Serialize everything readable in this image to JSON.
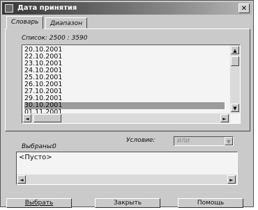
{
  "window": {
    "title": "Дата принятия",
    "close_label": "✕"
  },
  "tabs": [
    {
      "label": "Словарь",
      "active": true
    },
    {
      "label": "Диапазон",
      "active": false
    }
  ],
  "list": {
    "header": "Список:  2500 : 3590",
    "items": [
      "20.10.2001",
      "22.10.2001",
      "23.10.2001",
      "24.10.2001",
      "25.10.2001",
      "26.10.2001",
      "27.10.2001",
      "29.10.2001",
      "30.10.2001",
      "01.11.2001"
    ],
    "selected_index": 8
  },
  "condition": {
    "label": "Условие:",
    "value": "ИЛИ"
  },
  "selected": {
    "label": "Выбраны:",
    "count": "0",
    "empty_text": "<Пусто>"
  },
  "buttons": {
    "select": "Выбрать",
    "close": "Закрыть",
    "help": "Помощь"
  },
  "icons": {
    "scroll_up": "▲",
    "scroll_down": "▼",
    "scroll_left": "◄",
    "scroll_right": "►",
    "dropdown": "▼"
  }
}
